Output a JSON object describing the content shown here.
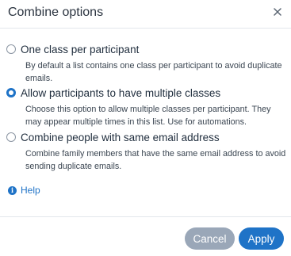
{
  "dialog": {
    "title": "Combine options",
    "close_icon": "close-icon"
  },
  "options": [
    {
      "title": "One class per participant",
      "description": "By default a list contains one class per participant to avoid duplicate emails.",
      "selected": false
    },
    {
      "title": "Allow participants to have multiple classes",
      "description": "Choose this option to allow multiple classes per participant. They may appear multiple times in this list. Use for automations.",
      "selected": true
    },
    {
      "title": "Combine people with same email address",
      "description": "Combine family members that have the same email address to avoid sending duplicate emails.",
      "selected": false
    }
  ],
  "help": {
    "label": "Help",
    "icon": "info-icon",
    "icon_glyph": "i"
  },
  "footer": {
    "cancel_label": "Cancel",
    "apply_label": "Apply"
  },
  "colors": {
    "accent": "#1f73c7",
    "cancel": "#9aa7b8"
  }
}
